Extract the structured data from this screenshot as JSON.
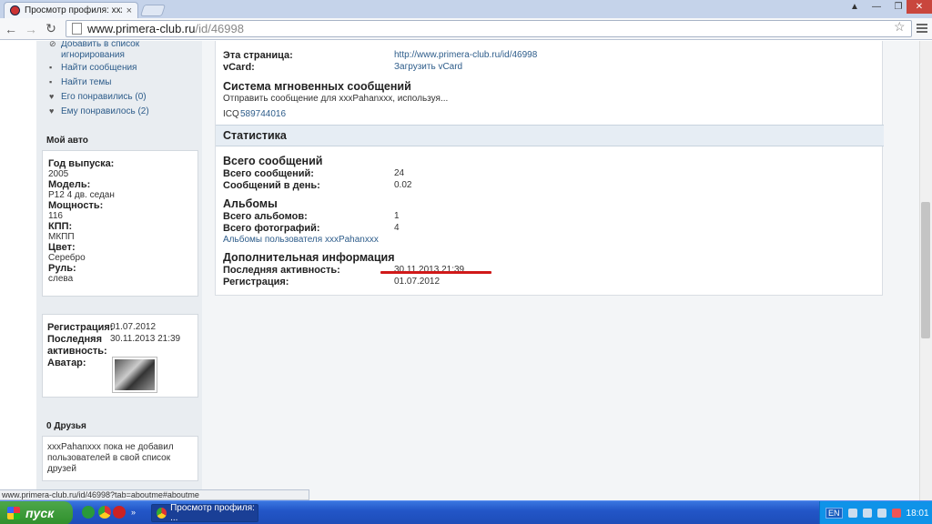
{
  "browser": {
    "tab_title": "Просмотр профиля: xxxPah",
    "url_host": "www.primera-club.ru",
    "url_path": "/id/46998",
    "status_url": "www.primera-club.ru/id/46998?tab=aboutme#aboutme"
  },
  "sidebar": {
    "links": [
      {
        "label": "Добавить в список игнорирования",
        "icon": "block-icon"
      },
      {
        "label": "Найти сообщения",
        "icon": "posts-icon"
      },
      {
        "label": "Найти темы",
        "icon": "threads-icon"
      },
      {
        "label": "Его понравились (0)",
        "icon": "heart-icon"
      },
      {
        "label": "Ему понравилось (2)",
        "icon": "heart-icon"
      }
    ],
    "car_heading": "Мой авто",
    "car": [
      {
        "k": "Год выпуска:",
        "v": "2005"
      },
      {
        "k": "Модель:",
        "v": "P12 4 дв. седан"
      },
      {
        "k": "Мощность:",
        "v": "116"
      },
      {
        "k": "КПП:",
        "v": "МКПП"
      },
      {
        "k": "Цвет:",
        "v": "Серебро"
      },
      {
        "k": "Руль:",
        "v": "слева"
      }
    ],
    "reg_label": "Регистрация:",
    "reg_value": "01.07.2012",
    "last_label": "Последняя активность:",
    "last_value": "30.11.2013 21:39",
    "avatar_label": "Аватар:",
    "friends_heading": "0 Друзья",
    "friends_text": "xxxPahanxxx пока не добавил пользователей в свой список друзей"
  },
  "main": {
    "page_label": "Эта страница:",
    "page_value": "http://www.primera-club.ru/id/46998",
    "vcard_label": "vCard:",
    "vcard_value": "Загрузить vCard",
    "im_heading": "Система мгновенных сообщений",
    "im_text": "Отправить сообщение для xxxPahanxxx, используя...",
    "icq_label": "ICQ",
    "icq_value": "589744016",
    "stats_heading": "Статистика",
    "posts_heading": "Всего сообщений",
    "posts_total_label": "Всего сообщений:",
    "posts_total_value": "24",
    "posts_day_label": "Сообщений в день:",
    "posts_day_value": "0.02",
    "albums_heading": "Альбомы",
    "albums_total_label": "Всего альбомов:",
    "albums_total_value": "1",
    "photos_total_label": "Всего фотографий:",
    "photos_total_value": "4",
    "albums_link": "Альбомы пользователя xxxPahanxxx",
    "extra_heading": "Дополнительная информация",
    "last_label": "Последняя активность:",
    "last_value": "30.11.2013 21:39",
    "reg_label": "Регистрация:",
    "reg_value": "01.07.2012"
  },
  "taskbar": {
    "start_label": "пуск",
    "task_label": "Просмотр профиля: ...",
    "lang": "EN",
    "clock": "18:01"
  }
}
